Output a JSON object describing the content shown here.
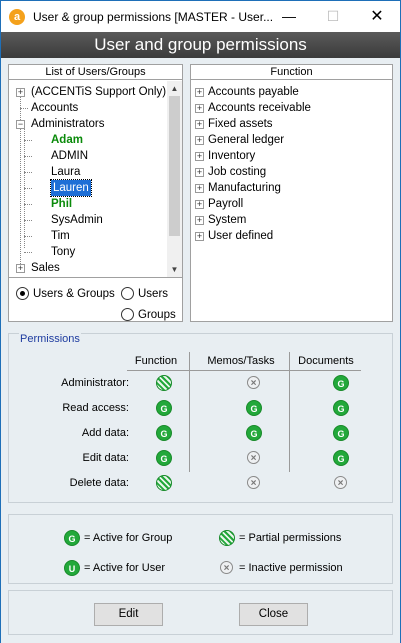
{
  "window": {
    "title": "User & group permissions [MASTER - User...",
    "app_icon_letter": "a",
    "minimize_glyph": "—",
    "maximize_glyph": "☐",
    "close_glyph": "✕"
  },
  "header": {
    "title": "User and group permissions"
  },
  "users_list": {
    "heading": "List of Users/Groups",
    "items": [
      {
        "label": "(ACCENTiS Support Only)",
        "expander": "+",
        "level": 0
      },
      {
        "label": "Accounts",
        "expander": "",
        "level": 0
      },
      {
        "label": "Administrators",
        "expander": "−",
        "level": 0
      },
      {
        "label": "Adam",
        "style": "bold-green",
        "level": 1
      },
      {
        "label": "ADMIN",
        "level": 1
      },
      {
        "label": "Laura",
        "level": 1
      },
      {
        "label": "Lauren",
        "level": 1,
        "selected": true
      },
      {
        "label": "Phil",
        "style": "bold-green",
        "level": 1
      },
      {
        "label": "SysAdmin",
        "level": 1
      },
      {
        "label": "Tim",
        "level": 1
      },
      {
        "label": "Tony",
        "level": 1
      },
      {
        "label": "Sales",
        "expander": "+",
        "level": 0
      }
    ],
    "scroll_up_glyph": "▲",
    "scroll_down_glyph": "▼"
  },
  "view_mode": {
    "options": [
      {
        "label": "Users & Groups",
        "selected": true
      },
      {
        "label": "Users",
        "selected": false
      },
      {
        "label": "Groups",
        "selected": false
      }
    ]
  },
  "function_list": {
    "heading": "Function",
    "items": [
      "Accounts payable",
      "Accounts receivable",
      "Fixed assets",
      "General ledger",
      "Inventory",
      "Job costing",
      "Manufacturing",
      "Payroll",
      "System",
      "User defined"
    ]
  },
  "permissions": {
    "title": "Permissions",
    "columns": [
      "Function",
      "Memos/Tasks",
      "Documents"
    ],
    "rows": [
      {
        "label": "Administrator:",
        "values": [
          "partial",
          "inactive",
          "group"
        ]
      },
      {
        "label": "Read access:",
        "values": [
          "group",
          "group",
          "group"
        ]
      },
      {
        "label": "Add data:",
        "values": [
          "group",
          "group",
          "group"
        ]
      },
      {
        "label": "Edit data:",
        "values": [
          "group",
          "inactive",
          "group"
        ]
      },
      {
        "label": "Delete data:",
        "values": [
          "partial",
          "inactive",
          "inactive"
        ]
      }
    ]
  },
  "legend": {
    "group_letter": "G",
    "user_letter": "U",
    "inactive_glyph": "×",
    "group_text": "= Active for Group",
    "user_text": "= Active for User",
    "partial_text": "= Partial permissions",
    "inactive_text": "= Inactive permission"
  },
  "buttons": {
    "edit": "Edit",
    "close": "Close"
  },
  "colors": {
    "active": "#22a83a",
    "selected": "#1e6fd6",
    "header_bg": "#4a4a4a"
  }
}
